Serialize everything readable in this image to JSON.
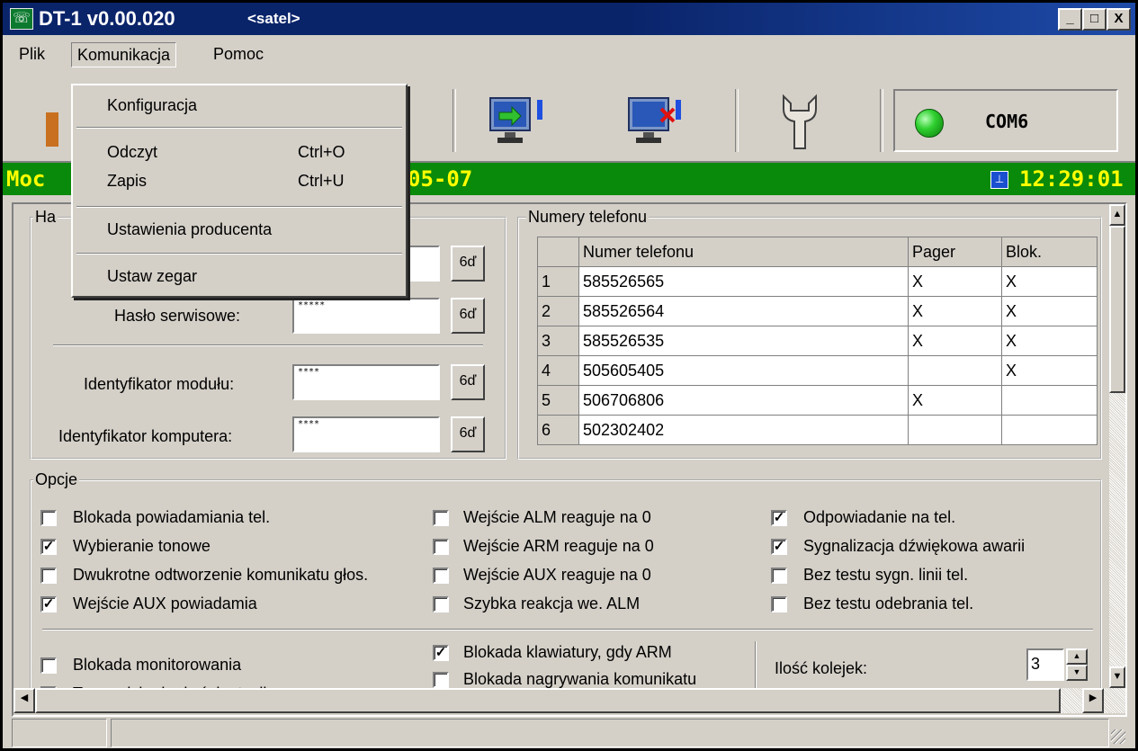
{
  "window": {
    "title": "DT-1 v0.00.020",
    "title_sub": "<satel>",
    "buttons": [
      "_",
      "□",
      "X"
    ]
  },
  "menubar": [
    "Plik",
    "Komunikacja",
    "Pomoc"
  ],
  "menu_open": "Komunikacja",
  "dropdown": {
    "items": [
      {
        "label": "Konfiguracja",
        "shortcut": ""
      },
      {
        "label": "Odczyt",
        "shortcut": "Ctrl+O"
      },
      {
        "label": "Zapis",
        "shortcut": "Ctrl+U"
      },
      {
        "label": "Ustawienia producenta",
        "shortcut": ""
      },
      {
        "label": "Ustaw zegar",
        "shortcut": ""
      }
    ]
  },
  "toolbar": {
    "com_port": "COM6",
    "icons": [
      "monitor-connect-icon",
      "monitor-disconnect-icon",
      "wrench-icon",
      "status-led-icon"
    ]
  },
  "green_bar": {
    "left_text": "Moc",
    "mid_text": "05-07",
    "time": "12:29:01"
  },
  "passwords": {
    "group_title": "Ha",
    "service_label": "Hasło serwisowe:",
    "service_value": "*****",
    "module_label": "Identyfikator modułu:",
    "module_value": "****",
    "computer_label": "Identyfikator komputera:",
    "computer_value": "****",
    "eye_label": "6ď"
  },
  "phones": {
    "group_title": "Numery telefonu",
    "headers": [
      "",
      "Numer telefonu",
      "Pager",
      "Blok."
    ],
    "rows": [
      {
        "n": "1",
        "number": "585526565",
        "pager": "X",
        "blok": "X"
      },
      {
        "n": "2",
        "number": "585526564",
        "pager": "X",
        "blok": "X"
      },
      {
        "n": "3",
        "number": "585526535",
        "pager": "X",
        "blok": "X"
      },
      {
        "n": "4",
        "number": "505605405",
        "pager": "",
        "blok": "X"
      },
      {
        "n": "5",
        "number": "506706806",
        "pager": "X",
        "blok": ""
      },
      {
        "n": "6",
        "number": "502302402",
        "pager": "",
        "blok": ""
      }
    ]
  },
  "options": {
    "group_title": "Opcje",
    "col1": [
      {
        "label": "Blokada powiadamiania tel.",
        "checked": false
      },
      {
        "label": "Wybieranie tonowe",
        "checked": true
      },
      {
        "label": "Dwukrotne odtworzenie komunikatu głos.",
        "checked": false
      },
      {
        "label": "Wejście AUX powiadamia",
        "checked": true
      }
    ],
    "col2": [
      {
        "label": "Wejście ALM reaguje na 0",
        "checked": false
      },
      {
        "label": "Wejście ARM reaguje na 0",
        "checked": false
      },
      {
        "label": "Wejście AUX reaguje na 0",
        "checked": false
      },
      {
        "label": "Szybka reakcja we. ALM",
        "checked": false
      }
    ],
    "col3": [
      {
        "label": "Odpowiadanie na tel.",
        "checked": true
      },
      {
        "label": "Sygnalizacja dźwiękowa awarii",
        "checked": true
      },
      {
        "label": "Bez testu sygn. linii tel.",
        "checked": false
      },
      {
        "label": "Bez testu odebrania tel.",
        "checked": false
      }
    ],
    "lower_col1": [
      {
        "label": "Blokada monitorowania",
        "checked": false
      },
      {
        "label": "Transmisja do dwóch stacji",
        "checked": false
      }
    ],
    "lower_col2": [
      {
        "label": "Blokada klawiatury, gdy ARM",
        "checked": true
      },
      {
        "label": "Blokada nagrywania komunikatu",
        "checked": false
      }
    ],
    "queue_label": "Ilość kolejek:",
    "queue_value": "3"
  }
}
